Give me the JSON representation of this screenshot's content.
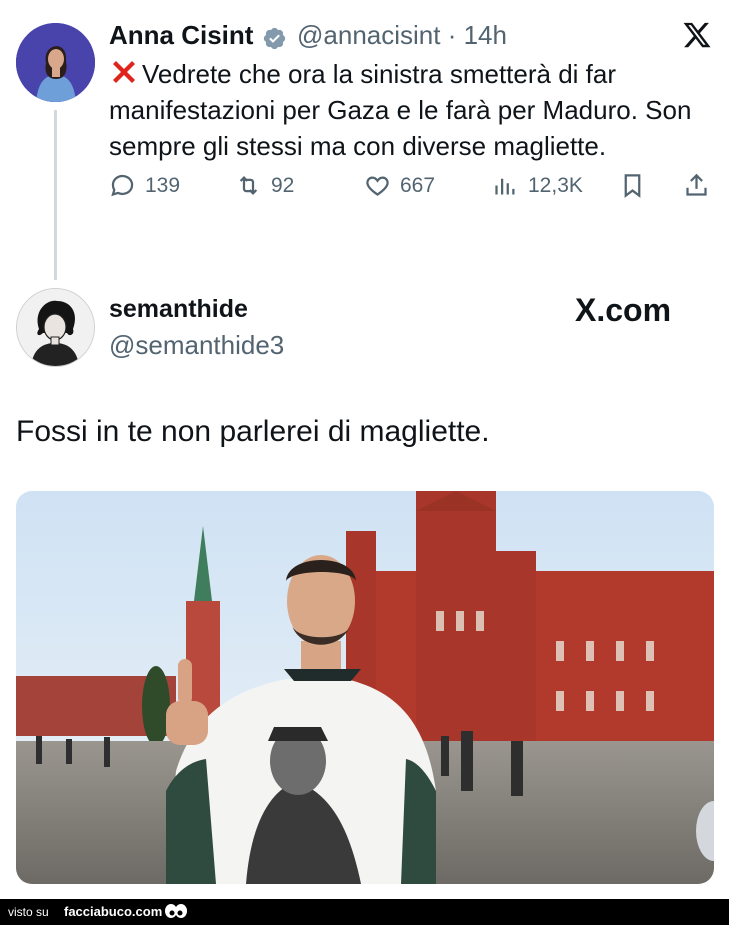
{
  "tweet": {
    "author_name": "Anna Cisint",
    "handle_time": "@annacisint · 14h",
    "text": "Vedrete che ora la sinistra smetterà di far manifestazioni per Gaza e le farà per Maduro. Son sempre gli stessi ma con diverse magliette.",
    "lead_icon": "red-cross-mark-emoji",
    "stats": {
      "replies": "139",
      "reposts": "92",
      "likes": "667",
      "views": "12,3K"
    }
  },
  "reply": {
    "author_name": "semanthide",
    "handle": "@semanthide3",
    "site_label": "X.com",
    "text": "Fossi in te non parlerei di magliette."
  },
  "footer": {
    "visto_su": "visto su",
    "brand": "facciabuco.com"
  },
  "colors": {
    "text": "#0f1419",
    "muted": "#536471",
    "verified": "#829aab",
    "cross": "#e0241b"
  }
}
